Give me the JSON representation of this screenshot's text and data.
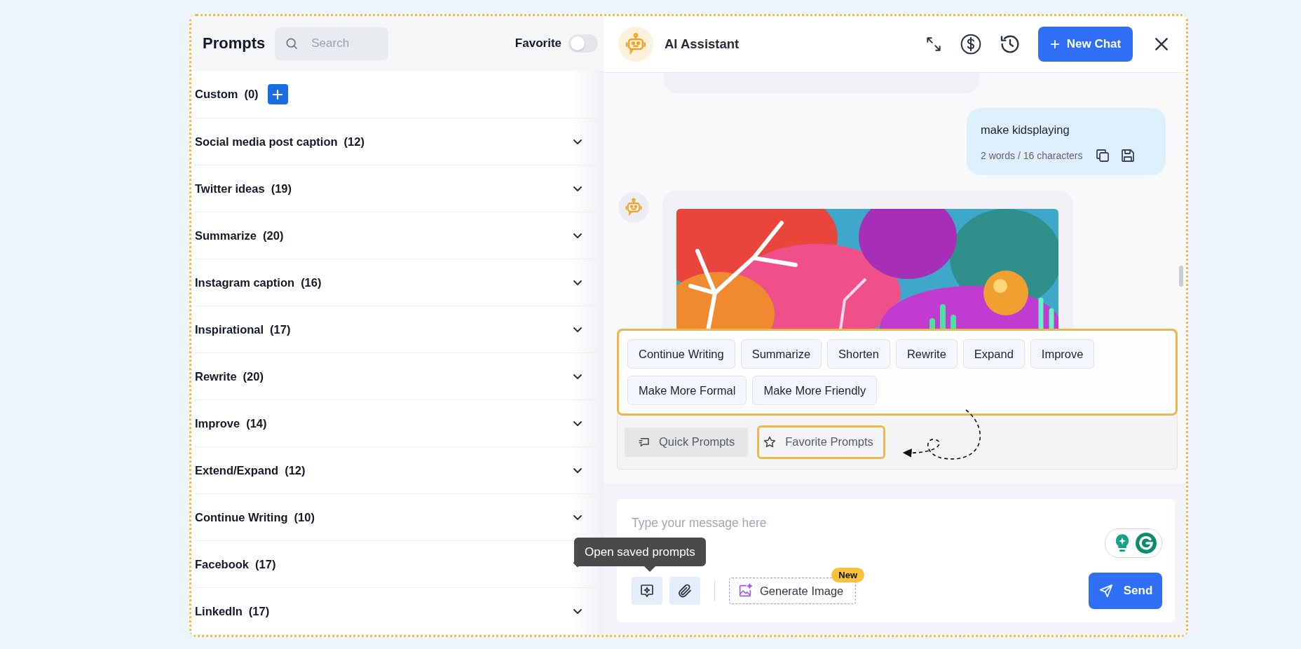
{
  "prompts_panel": {
    "title": "Prompts",
    "search": {
      "placeholder": "Search"
    },
    "favorite_toggle": {
      "label": "Favorite",
      "on": false
    },
    "custom": {
      "label": "Custom",
      "count": "(0)"
    },
    "categories": [
      {
        "label": "Social media post caption",
        "count": "(12)",
        "expanded": false
      },
      {
        "label": "Twitter ideas",
        "count": "(19)",
        "expanded": false
      },
      {
        "label": "Summarize",
        "count": "(20)",
        "expanded": false
      },
      {
        "label": "Instagram caption",
        "count": "(16)",
        "expanded": false
      },
      {
        "label": "Inspirational",
        "count": "(17)",
        "expanded": false
      },
      {
        "label": "Rewrite",
        "count": "(20)",
        "expanded": false
      },
      {
        "label": "Improve",
        "count": "(14)",
        "expanded": false
      },
      {
        "label": "Extend/Expand",
        "count": "(12)",
        "expanded": false
      },
      {
        "label": "Continue Writing",
        "count": "(10)",
        "expanded": false
      },
      {
        "label": "Facebook",
        "count": "(17)",
        "expanded": false
      },
      {
        "label": "LinkedIn",
        "count": "(17)",
        "expanded": false
      }
    ]
  },
  "chat": {
    "title": "AI Assistant",
    "new_chat_button": "New Chat",
    "messages": [
      {
        "kind": "partial"
      },
      {
        "kind": "user",
        "text": "make kidsplaying",
        "stats": "2 words / 16 characters"
      },
      {
        "kind": "bot_image"
      }
    ],
    "quick_prompts": {
      "highlighted": true,
      "items": [
        "Continue Writing",
        "Summarize",
        "Shorten",
        "Rewrite",
        "Expand",
        "Improve",
        "Make More Formal",
        "Make More Friendly"
      ]
    },
    "prompt_tabs": [
      {
        "label": "Quick Prompts",
        "selected": true,
        "highlighted": false
      },
      {
        "label": "Favorite Prompts",
        "selected": false,
        "highlighted": true
      }
    ],
    "composer": {
      "placeholder": "Type your message here",
      "tooltip": "Open saved prompts",
      "generate_image": "Generate Image",
      "badge": "New",
      "send": "Send"
    }
  }
}
